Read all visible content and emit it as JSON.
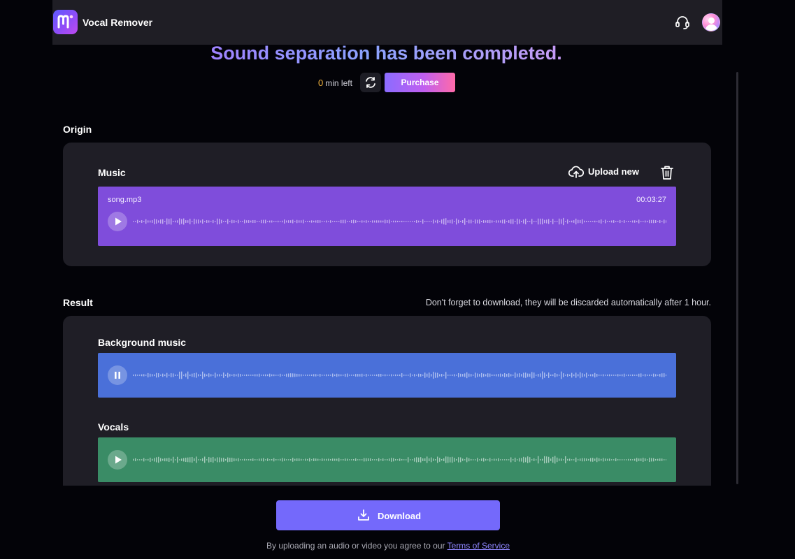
{
  "header": {
    "app_title": "Vocal Remover",
    "logo_icon": "m-logo-icon",
    "support_icon": "headset-icon",
    "avatar_icon": "user-avatar-icon"
  },
  "headline": "Sound separation has been completed.",
  "quota": {
    "minutes": "0",
    "label": "min left",
    "refresh_icon": "refresh-icon",
    "purchase_label": "Purchase"
  },
  "origin": {
    "section_label": "Origin",
    "track_title": "Music",
    "upload_label": "Upload new",
    "upload_icon": "cloud-upload-icon",
    "delete_icon": "trash-icon",
    "file_name": "song.mp3",
    "duration": "00:03:27",
    "player_color": "#7f4ddb",
    "state": "paused"
  },
  "result": {
    "section_label": "Result",
    "note": "Don't forget to download, they will be discarded automatically after 1 hour.",
    "tracks": [
      {
        "title": "Background music",
        "color": "#4a70d9",
        "state": "playing"
      },
      {
        "title": "Vocals",
        "color": "#3a8c66",
        "state": "paused"
      }
    ]
  },
  "download": {
    "label": "Download",
    "icon": "download-icon"
  },
  "footer": {
    "terms_prefix": "By uploading an audio or video you agree to our",
    "terms_link": "Terms of Service"
  },
  "colors": {
    "accent": "#7469fb",
    "quota_number": "#f2b33d"
  }
}
